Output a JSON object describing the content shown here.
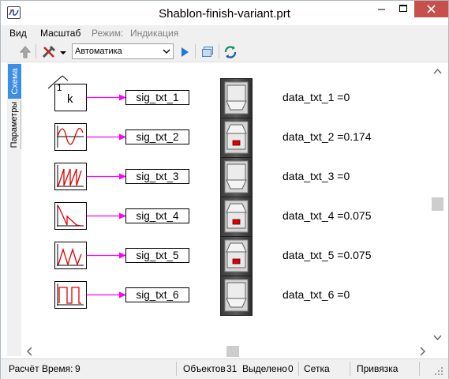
{
  "window": {
    "title": "Shablon-finish-variant.prt",
    "close_color": "#c7504b"
  },
  "menu": {
    "items": [
      "Вид",
      "Масштаб"
    ],
    "mode_label": "Режим:",
    "mode_value": "Индикация"
  },
  "toolbar": {
    "run_mode": "Автоматика",
    "icons": [
      "up-arrow-icon",
      "tools-icon",
      "play-icon",
      "windows-icon",
      "refresh-icon"
    ]
  },
  "side_tabs": [
    "Схема",
    "Параметры"
  ],
  "diagram": {
    "constant_block": {
      "top_label": "1",
      "letter": "k"
    },
    "rows": [
      {
        "source": "constant",
        "signal": "sig_txt_1",
        "display_label": "data_txt_1",
        "value": "0",
        "switch_on": false
      },
      {
        "source": "sine",
        "signal": "sig_txt_2",
        "display_label": "data_txt_2",
        "value": "0.174",
        "switch_on": true
      },
      {
        "source": "sawtooth",
        "signal": "sig_txt_3",
        "display_label": "data_txt_3",
        "value": "0",
        "switch_on": false
      },
      {
        "source": "ramp-down",
        "signal": "sig_txt_4",
        "display_label": "data_txt_4",
        "value": "0.075",
        "switch_on": true
      },
      {
        "source": "triangle",
        "signal": "sig_txt_5",
        "display_label": "data_txt_5",
        "value": "0.075",
        "switch_on": true
      },
      {
        "source": "square",
        "signal": "sig_txt_6",
        "display_label": "data_txt_6",
        "value": "0",
        "switch_on": false
      }
    ],
    "colors": {
      "arrow": "#ff00ff",
      "waveform": "#e00000",
      "axis": "#000000",
      "indicator_red": "#e00000"
    }
  },
  "status": {
    "calc_label": "Расчёт",
    "time_label": "Время:",
    "time_value": "9",
    "objects_label": "Объектов",
    "objects_value": "31",
    "selected_label": "Выделено",
    "selected_value": "0",
    "grid_label": "Сетка",
    "snap_label": "Привязка"
  }
}
